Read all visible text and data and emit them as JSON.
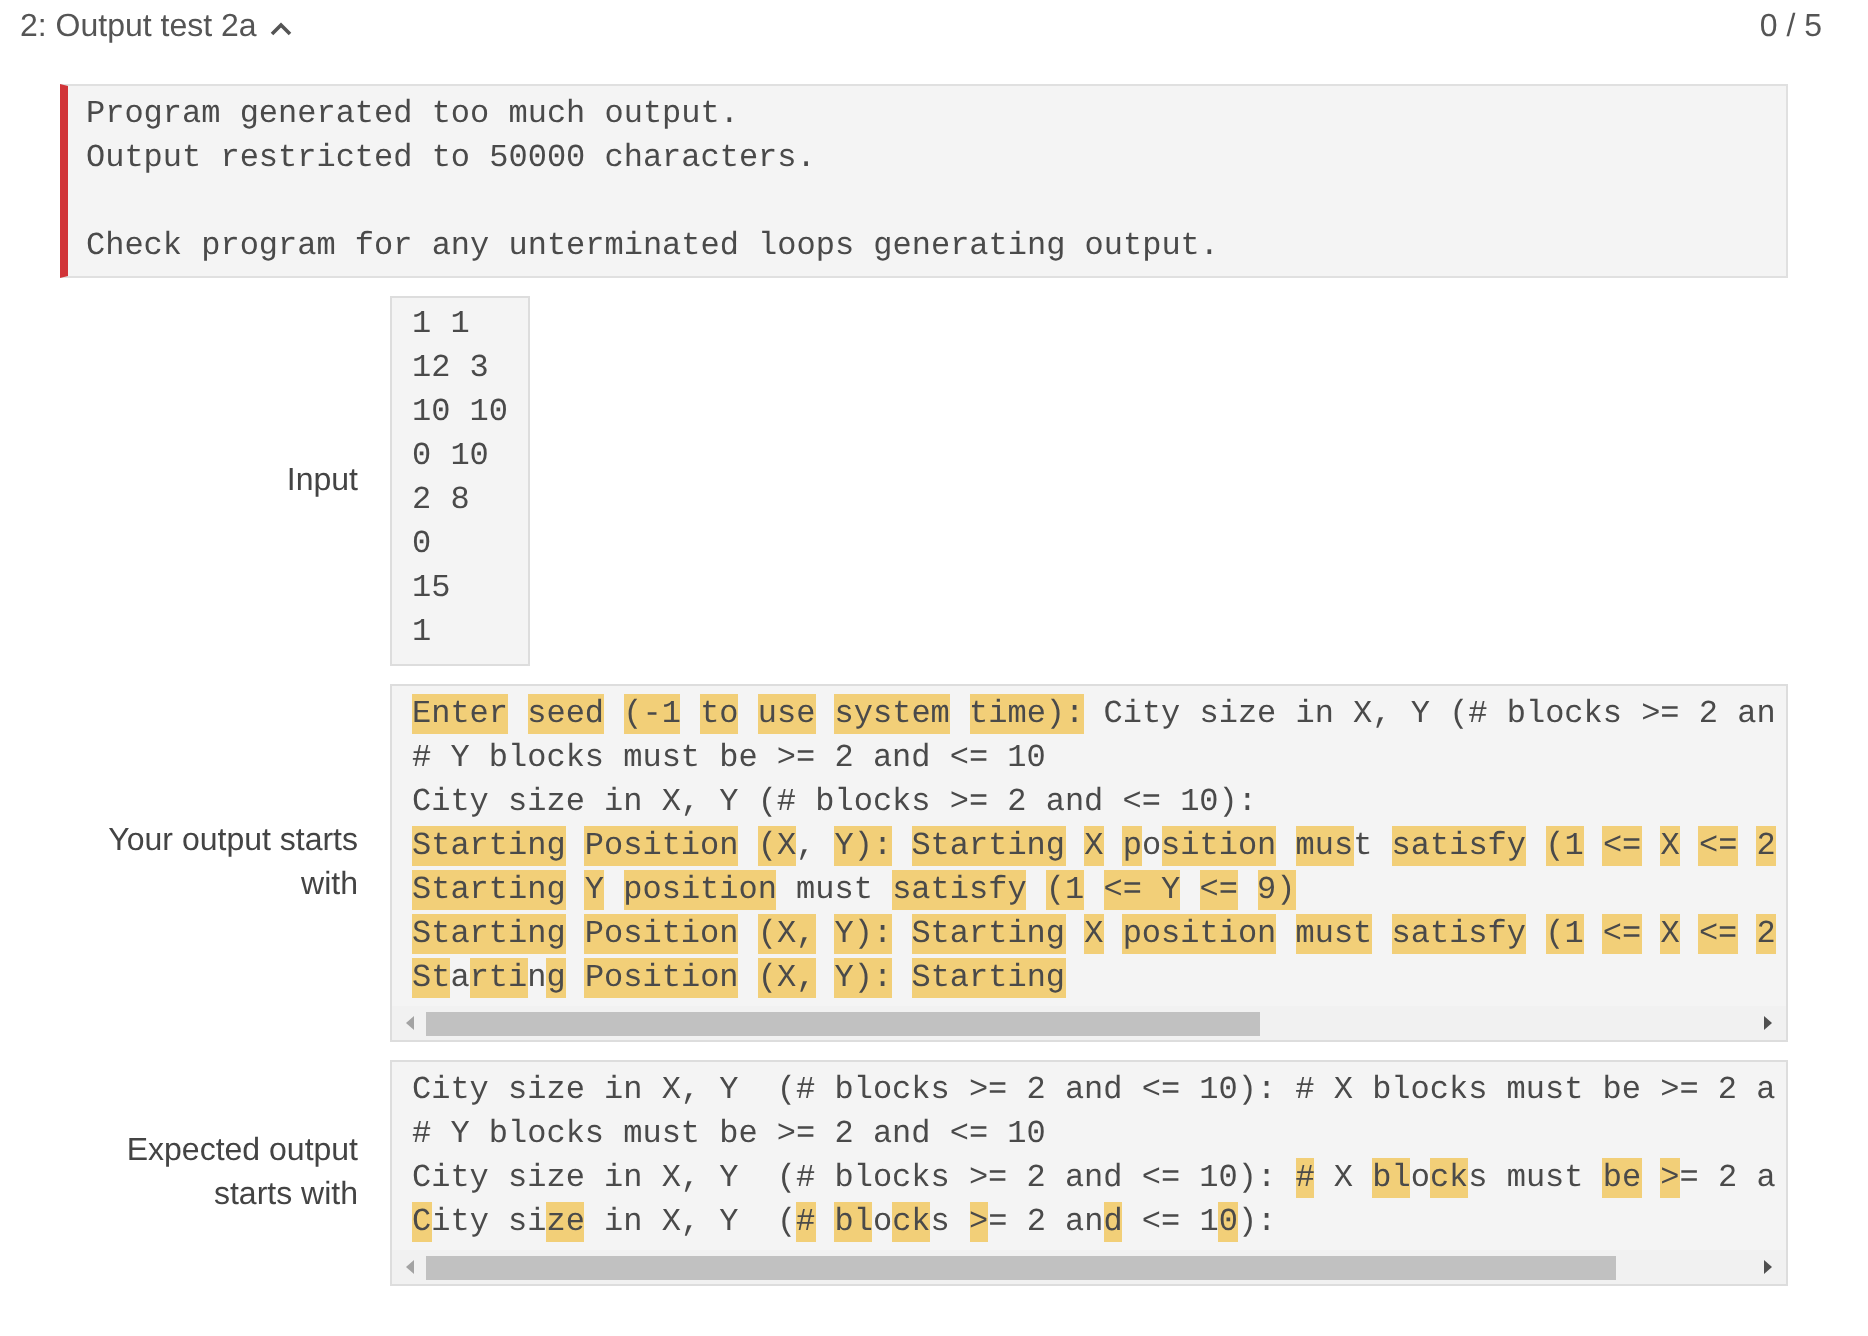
{
  "header": {
    "title": "2: Output test 2a",
    "expanded": true,
    "score": "0 / 5"
  },
  "error": {
    "paragraphs": [
      [
        "Program generated too much output.",
        "Output restricted to 50000 characters."
      ],
      [
        "Check program for any unterminated loops generating output."
      ]
    ]
  },
  "input": {
    "label": "Input",
    "lines": [
      "1 1",
      "12 3",
      "10 10",
      "0 10",
      "2 8",
      "0",
      "15",
      "1"
    ]
  },
  "your_output": {
    "label": "Your output starts with",
    "lines": [
      {
        "chunks": [
          [
            {
              "text": "Enter",
              "highlighted": true
            }
          ],
          [
            {
              "text": "seed",
              "highlighted": true
            }
          ],
          [
            {
              "text": "(-1",
              "highlighted": true
            }
          ],
          [
            {
              "text": "to",
              "highlighted": true
            }
          ],
          [
            {
              "text": "use",
              "highlighted": true
            }
          ],
          [
            {
              "text": "system",
              "highlighted": true
            }
          ],
          [
            {
              "text": "time):",
              "highlighted": true
            }
          ],
          [
            {
              "text": "City size in X, Y (# blocks >= 2 an",
              "highlighted": false
            }
          ]
        ]
      },
      {
        "chunks": [
          [
            {
              "text": "# Y blocks must be >= 2 and <= 10",
              "highlighted": false
            }
          ]
        ]
      },
      {
        "chunks": [
          [
            {
              "text": "City size in X, Y (# blocks >= 2 and <= 10):",
              "highlighted": false
            }
          ]
        ]
      },
      {
        "chunks": [
          [
            {
              "text": "Starting",
              "highlighted": true
            }
          ],
          [
            {
              "text": "Position",
              "highlighted": true
            }
          ],
          [
            {
              "text": "(X",
              "highlighted": true
            },
            {
              "text": ",",
              "highlighted": false
            }
          ],
          [
            {
              "text": "Y):",
              "highlighted": true
            }
          ],
          [
            {
              "text": "Starting",
              "highlighted": true
            }
          ],
          [
            {
              "text": "X",
              "highlighted": true
            }
          ],
          [
            {
              "text": "p",
              "highlighted": true
            },
            {
              "text": "o",
              "highlighted": false
            },
            {
              "text": "sition",
              "highlighted": true
            }
          ],
          [
            {
              "text": "mus",
              "highlighted": true
            },
            {
              "text": "t",
              "highlighted": false
            }
          ],
          [
            {
              "text": "satisfy",
              "highlighted": true
            }
          ],
          [
            {
              "text": "(1",
              "highlighted": true
            }
          ],
          [
            {
              "text": "<=",
              "highlighted": true
            }
          ],
          [
            {
              "text": "X",
              "highlighted": true
            }
          ],
          [
            {
              "text": "<=",
              "highlighted": true
            }
          ],
          [
            {
              "text": "2",
              "highlighted": true
            }
          ]
        ]
      },
      {
        "chunks": [
          [
            {
              "text": "Starting",
              "highlighted": true
            }
          ],
          [
            {
              "text": "Y",
              "highlighted": true
            }
          ],
          [
            {
              "text": "position",
              "highlighted": true
            },
            {
              "text": " must",
              "highlighted": false
            }
          ],
          [
            {
              "text": "satisfy",
              "highlighted": true
            }
          ],
          [
            {
              "text": "(1",
              "highlighted": true
            }
          ],
          [
            {
              "text": "<= Y",
              "highlighted": true
            }
          ],
          [
            {
              "text": "<=",
              "highlighted": true
            }
          ],
          [
            {
              "text": "9)",
              "highlighted": true
            }
          ]
        ]
      },
      {
        "chunks": [
          [
            {
              "text": "Starting",
              "highlighted": true
            }
          ],
          [
            {
              "text": "Position",
              "highlighted": true
            }
          ],
          [
            {
              "text": "(X,",
              "highlighted": true
            }
          ],
          [
            {
              "text": "Y):",
              "highlighted": true
            }
          ],
          [
            {
              "text": "Starting",
              "highlighted": true
            }
          ],
          [
            {
              "text": "X",
              "highlighted": true
            }
          ],
          [
            {
              "text": "position",
              "highlighted": true
            }
          ],
          [
            {
              "text": "must",
              "highlighted": true
            }
          ],
          [
            {
              "text": "satisfy",
              "highlighted": true
            }
          ],
          [
            {
              "text": "(1",
              "highlighted": true
            }
          ],
          [
            {
              "text": "<=",
              "highlighted": true
            }
          ],
          [
            {
              "text": "X",
              "highlighted": true
            }
          ],
          [
            {
              "text": "<=",
              "highlighted": true
            }
          ],
          [
            {
              "text": "2",
              "highlighted": true
            }
          ]
        ]
      },
      {
        "chunks": [
          [
            {
              "text": "St",
              "highlighted": true
            },
            {
              "text": "a",
              "highlighted": false
            },
            {
              "text": "rti",
              "highlighted": true
            },
            {
              "text": "n",
              "highlighted": false
            },
            {
              "text": "g",
              "highlighted": true
            }
          ],
          [
            {
              "text": "Position",
              "highlighted": true
            }
          ],
          [
            {
              "text": "(X,",
              "highlighted": true
            }
          ],
          [
            {
              "text": "Y):",
              "highlighted": true
            }
          ],
          [
            {
              "text": "Starting",
              "highlighted": true
            }
          ]
        ]
      }
    ]
  },
  "expected_output": {
    "label": "Expected output starts with",
    "lines": [
      {
        "chunks": [
          [
            {
              "text": "City size in X, Y  (# blocks >= 2 and <= 10): # X blocks must be >= 2 a",
              "highlighted": false
            }
          ]
        ]
      },
      {
        "chunks": [
          [
            {
              "text": "# Y blocks must be >= 2 and <= 10",
              "highlighted": false
            }
          ]
        ]
      },
      {
        "chunks": [
          [
            {
              "text": "City size in X, Y  (# blocks >= 2 and <= 10):",
              "highlighted": false
            }
          ],
          [
            {
              "text": "#",
              "highlighted": true
            }
          ],
          [
            {
              "text": "X",
              "highlighted": false
            }
          ],
          [
            {
              "text": "bl",
              "highlighted": true
            },
            {
              "text": "o",
              "highlighted": false
            },
            {
              "text": "ck",
              "highlighted": true
            },
            {
              "text": "s must",
              "highlighted": false
            }
          ],
          [
            {
              "text": "be",
              "highlighted": true
            }
          ],
          [
            {
              "text": ">",
              "highlighted": true
            },
            {
              "text": "= 2 a",
              "highlighted": false
            }
          ]
        ]
      },
      {
        "chunks": [
          [
            {
              "text": "C",
              "highlighted": true
            },
            {
              "text": "ity si",
              "highlighted": false
            },
            {
              "text": "ze",
              "highlighted": true
            },
            {
              "text": " in X, Y  (",
              "highlighted": false
            },
            {
              "text": "#",
              "highlighted": true
            }
          ],
          [
            {
              "text": "bl",
              "highlighted": true
            },
            {
              "text": "o",
              "highlighted": false
            },
            {
              "text": "ck",
              "highlighted": true
            },
            {
              "text": "s",
              "highlighted": false
            }
          ],
          [
            {
              "text": ">",
              "highlighted": true
            },
            {
              "text": "= 2 an",
              "highlighted": false
            },
            {
              "text": "d",
              "highlighted": true
            },
            {
              "text": " <= 1",
              "highlighted": false
            },
            {
              "text": "0",
              "highlighted": true
            },
            {
              "text": "):",
              "highlighted": false
            }
          ]
        ]
      }
    ]
  }
}
